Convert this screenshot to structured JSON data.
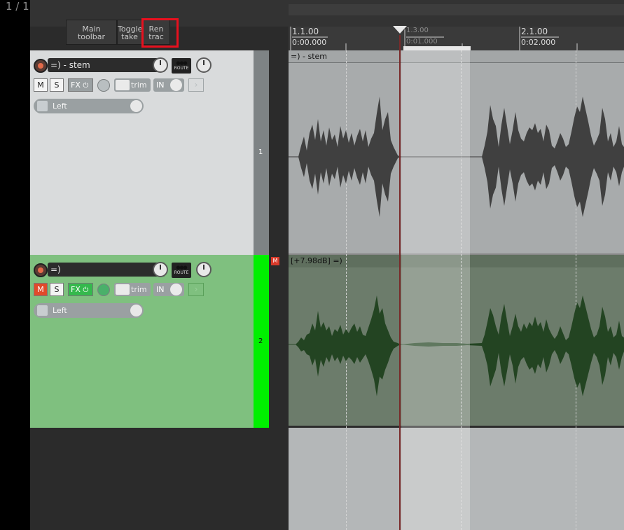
{
  "page_indicator": "1 / 1",
  "toolbar": {
    "buttons": [
      {
        "label": "Main\ntoolbar"
      },
      {
        "label": "Toggle\ntake"
      },
      {
        "label": "Ren\ntrac"
      }
    ]
  },
  "ruler": {
    "marks": [
      {
        "bar": "1.1.00",
        "time": "0:00.000"
      },
      {
        "bar": "1.3.00",
        "time": "0:01.000"
      },
      {
        "bar": "2.1.00",
        "time": "0:02.000"
      }
    ]
  },
  "tracks": [
    {
      "number": "1",
      "name": "=) - stem",
      "mute_label": "M",
      "solo_label": "S",
      "fx_label": "FX",
      "trim_label": "trim",
      "in_label": "IN",
      "route_label": "ROUTE",
      "channel": "Left",
      "item_label": "=) - stem",
      "color": "#d9dbdc"
    },
    {
      "number": "2",
      "name": "=)",
      "mute_label": "M",
      "solo_label": "S",
      "fx_label": "FX",
      "trim_label": "trim",
      "in_label": "IN",
      "route_label": "ROUTE",
      "channel": "Left",
      "item_label": "[+7.98dB] =)",
      "mute_marker": "M",
      "color": "#7fc07f"
    }
  ],
  "colors": {
    "highlight": "#e8101e",
    "mute_active": "#e04a2a",
    "fx_active": "#35b94d",
    "track2_number_bg": "#00f000"
  }
}
